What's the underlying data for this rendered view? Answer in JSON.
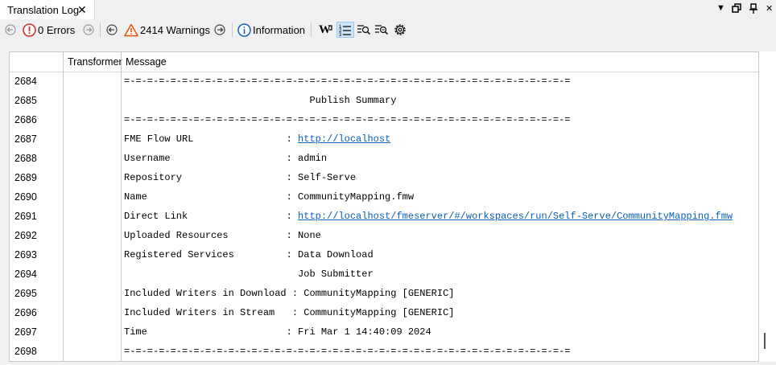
{
  "tab": {
    "title": "Translation Log",
    "close": "✕"
  },
  "window_controls": {
    "dropdown": "▼",
    "restore": "🗗",
    "pin": "📌",
    "close": "✕"
  },
  "toolbar": {
    "errors": "0 Errors",
    "warnings": "2414 Warnings",
    "information": "Information"
  },
  "table": {
    "columns": [
      "",
      "Transformer",
      "Message"
    ],
    "rows": [
      {
        "num": "2684",
        "pre": "=-=-=-=-=-=-=-=-=-=-=-=-=-=-=-=-=-=-=-=-=-=-=-=-=-=-=-=-=-=-=-=-=-=-=-=-=-=-=",
        "link": ""
      },
      {
        "num": "2685",
        "pre": "                                Publish Summary",
        "link": ""
      },
      {
        "num": "2686",
        "pre": "=-=-=-=-=-=-=-=-=-=-=-=-=-=-=-=-=-=-=-=-=-=-=-=-=-=-=-=-=-=-=-=-=-=-=-=-=-=-=",
        "link": ""
      },
      {
        "num": "2687",
        "pre": "FME Flow URL                : ",
        "link": "http://localhost"
      },
      {
        "num": "2688",
        "pre": "Username                    : admin",
        "link": ""
      },
      {
        "num": "2689",
        "pre": "Repository                  : Self-Serve",
        "link": ""
      },
      {
        "num": "2690",
        "pre": "Name                        : CommunityMapping.fmw",
        "link": ""
      },
      {
        "num": "2691",
        "pre": "Direct Link                 : ",
        "link": "http://localhost/fmeserver/#/workspaces/run/Self-Serve/CommunityMapping.fmw"
      },
      {
        "num": "2692",
        "pre": "Uploaded Resources          : None",
        "link": ""
      },
      {
        "num": "2693",
        "pre": "Registered Services         : Data Download",
        "link": ""
      },
      {
        "num": "2694",
        "pre": "                              Job Submitter",
        "link": ""
      },
      {
        "num": "2695",
        "pre": "Included Writers in Download : CommunityMapping [GENERIC]",
        "link": ""
      },
      {
        "num": "2696",
        "pre": "Included Writers in Stream   : CommunityMapping [GENERIC]",
        "link": ""
      },
      {
        "num": "2697",
        "pre": "Time                        : Fri Mar 1 14:40:09 2024",
        "link": ""
      },
      {
        "num": "2698",
        "pre": "=-=-=-=-=-=-=-=-=-=-=-=-=-=-=-=-=-=-=-=-=-=-=-=-=-=-=-=-=-=-=-=-=-=-=-=-=-=-=",
        "link": ""
      }
    ]
  },
  "colors": {
    "error": "#d32f2f",
    "warning": "#e65100",
    "info": "#1565c0",
    "link": "#0b5fbd"
  },
  "icons": [
    "back-icon",
    "error-icon",
    "forward-icon",
    "warning-icon",
    "info-icon",
    "wrap-text-icon",
    "numbered-list-icon",
    "find-icon",
    "filter-icon",
    "settings-icon"
  ]
}
